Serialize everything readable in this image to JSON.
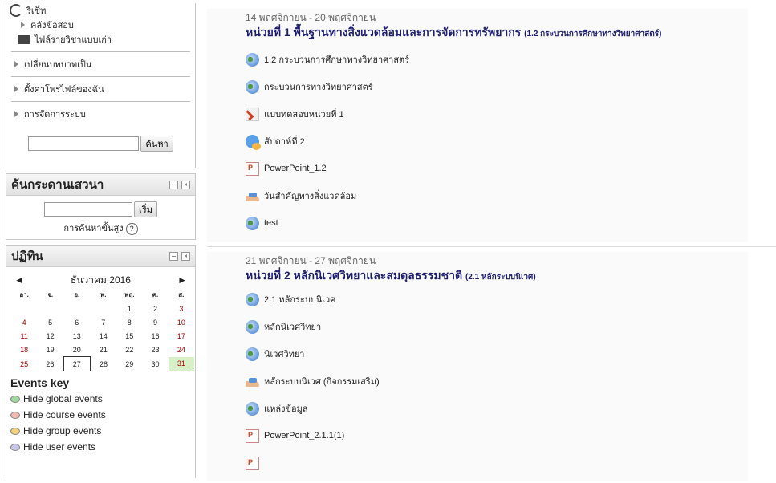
{
  "nav": {
    "reset": "รีเซ็ท",
    "question_bank": "คลังข้อสอบ",
    "legacy_files": "ไฟล์รายวิชาแบบเก่า",
    "switch_role": "เปลี่ยนบทบาทเป็น",
    "profile_settings": "ตั้งค่าโพรไฟล์ของฉัน",
    "site_admin": "การจัดการระบบ",
    "search_button": "ค้นหา"
  },
  "forum_search": {
    "title": "ค้นกระดานเสวนา",
    "go_button": "เริ่ม",
    "advanced": "การค้นหาขั้นสูง"
  },
  "calendar": {
    "title": "ปฏิทิน",
    "month": "ธันวาคม 2016",
    "weekdays": [
      "อา.",
      "จ.",
      "อ.",
      "พ.",
      "พฤ.",
      "ศ.",
      "ส."
    ],
    "weeks": [
      [
        "",
        "",
        "",
        "",
        "1",
        "2",
        "3"
      ],
      [
        "4",
        "5",
        "6",
        "7",
        "8",
        "9",
        "10"
      ],
      [
        "11",
        "12",
        "13",
        "14",
        "15",
        "16",
        "17"
      ],
      [
        "18",
        "19",
        "20",
        "21",
        "22",
        "23",
        "24"
      ],
      [
        "25",
        "26",
        "27",
        "28",
        "29",
        "30",
        "31"
      ]
    ],
    "today": "27",
    "event_day": "31",
    "events_key_title": "Events key",
    "events_key": [
      {
        "label": "Hide global events",
        "color": "#9fd89f"
      },
      {
        "label": "Hide course events",
        "color": "#f0b8b0"
      },
      {
        "label": "Hide group events",
        "color": "#f4d07a"
      },
      {
        "label": "Hide user events",
        "color": "#c8c8e8"
      }
    ]
  },
  "sections": [
    {
      "date": "14 พฤศจิกายน - 20 พฤศจิกายน",
      "title": "หน่วยที่ 1 พื้นฐานทางสิ่งแวดล้อมและการจัดการทรัพยากร",
      "subtitle": "(1.2 กระบวนการศึกษาทางวิทยาศาสตร์)",
      "activities": [
        {
          "icon": "globe",
          "label": "1.2 กระบวนการศึกษาทางวิทยาศาสตร์"
        },
        {
          "icon": "globe",
          "label": "กระบวนการทางวิทยาศาสตร์"
        },
        {
          "icon": "check",
          "label": "แบบทดสอบหน่วยที่ 1"
        },
        {
          "icon": "chat",
          "label": "สัปดาห์ที่ 2"
        },
        {
          "icon": "ppt",
          "label": "PowerPoint_1.2"
        },
        {
          "icon": "hand",
          "label": "วันสำคัญทางสิ่งแวดล้อม"
        },
        {
          "icon": "globe",
          "label": "test"
        }
      ]
    },
    {
      "date": "21 พฤศจิกายน - 27 พฤศจิกายน",
      "title": "หน่วยที่ 2 หลักนิเวศวิทยาและสมดุลธรรมชาติ",
      "subtitle": "(2.1 หลักระบบนิเวศ)",
      "activities": [
        {
          "icon": "globe",
          "label": "2.1 หลักระบบนิเวศ"
        },
        {
          "icon": "globe",
          "label": "หลักนิเวศวิทยา"
        },
        {
          "icon": "globe",
          "label": "นิเวศวิทยา"
        },
        {
          "icon": "hand",
          "label": "หลักระบบนิเวศ (กิจกรรมเสริม)"
        },
        {
          "icon": "globe",
          "label": "แหล่งข้อมูล"
        },
        {
          "icon": "ppt",
          "label": "PowerPoint_2.1.1(1)"
        },
        {
          "icon": "ppt",
          "label": ""
        }
      ]
    }
  ]
}
